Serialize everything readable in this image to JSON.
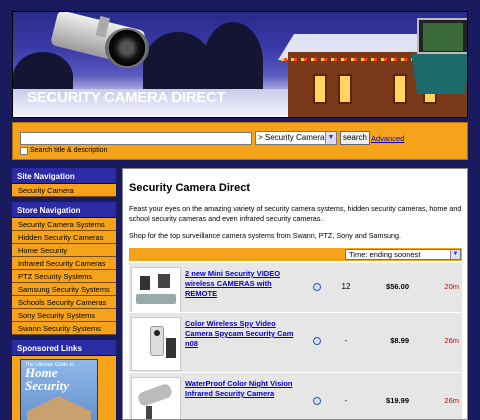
{
  "banner": {
    "title": "SECURITY CAMERA DIRECT"
  },
  "search": {
    "placeholder": "",
    "category": "> Security Camera",
    "button": "search",
    "advanced": "Advanced",
    "checkbox_label": "Search title & description"
  },
  "sidebar": {
    "site_nav_title": "Site Navigation",
    "site_nav_items": [
      "Security Camera"
    ],
    "store_nav_title": "Store Navigation",
    "store_nav_items": [
      "Security Camera Systems",
      "Hidden Security Cameras",
      "Home Security",
      "Infrared Security Cameras",
      "PTZ Security Systems",
      "Samsung Security Systems",
      "Schools Security Cameras",
      "Sony Security Systems",
      "Swann Security Systems"
    ],
    "sponsored_title": "Sponsored Links",
    "book": {
      "top": "The Ultimate Guide to",
      "title": "Home Security"
    }
  },
  "main": {
    "title": "Security Camera Direct",
    "intro": "Feast your eyes on the amazing variety of security camera systems, hidden security cameras, home and school security cameras and even infrared security cameras.",
    "shop": "Shop for the top surveillance camera systems from Swann, PTZ, Sony and Samsung.",
    "sort": "Time: ending soonest",
    "listings": [
      {
        "title": "2 new Mini Security VIDEO wireless CAMERAS with REMOTE",
        "bids": "12",
        "price": "$56.00",
        "time": "20m"
      },
      {
        "title": "Color Wireless Spy Video Camera Spycam Security Cam n08",
        "bids": "-",
        "price": "$8.99",
        "time": "26m"
      },
      {
        "title": "WaterProof Color Night Vision Infrared Security Camera",
        "bids": "-",
        "price": "$19.99",
        "time": "26m"
      }
    ]
  }
}
